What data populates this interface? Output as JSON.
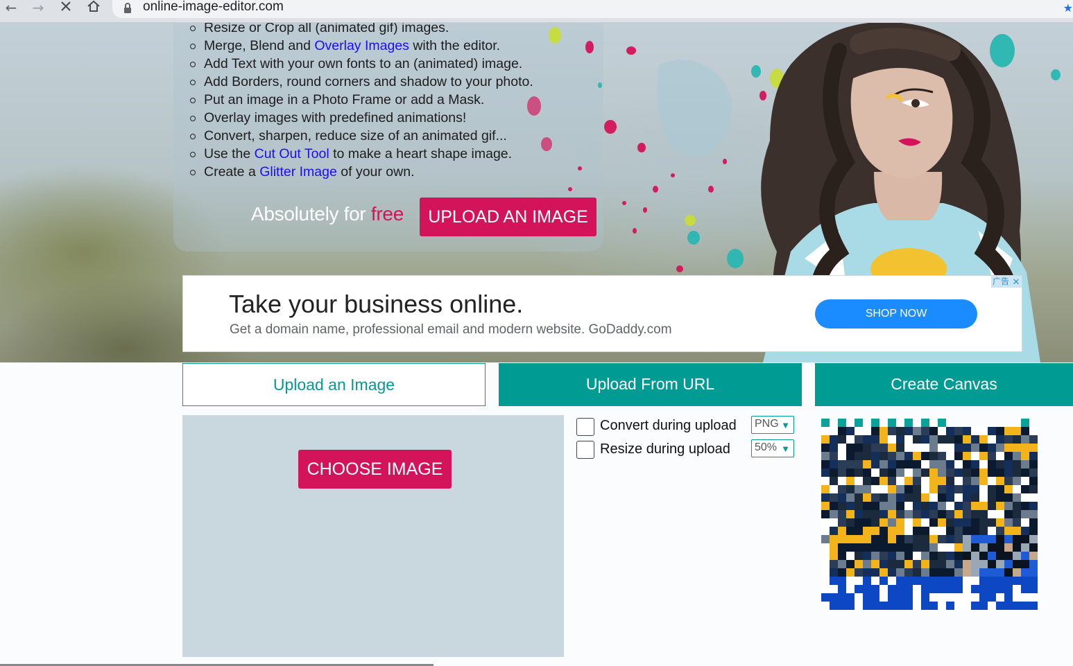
{
  "browser": {
    "url": "online-image-editor.com"
  },
  "hero": {
    "features": [
      {
        "before": "Resize or Crop all (animated gif) images.",
        "link": "",
        "after": ""
      },
      {
        "before": "Merge, Blend and ",
        "link": "Overlay Images",
        "after": " with the editor."
      },
      {
        "before": "Add Text with your own fonts to an (animated) image.",
        "link": "",
        "after": ""
      },
      {
        "before": "Add Borders, round corners and shadow to your photo.",
        "link": "",
        "after": ""
      },
      {
        "before": "Put an image in a Photo Frame or add a Mask.",
        "link": "",
        "after": ""
      },
      {
        "before": "Overlay images with predefined animations!",
        "link": "",
        "after": ""
      },
      {
        "before": "Convert, sharpen, reduce size of an animated gif...",
        "link": "",
        "after": ""
      },
      {
        "before": "Use the ",
        "link": "Cut Out Tool",
        "after": " to make a heart shape image."
      },
      {
        "before": "Create a ",
        "link": "Glitter Image",
        "after": " of your own."
      }
    ],
    "tagline_prefix": "Absolutely for ",
    "tagline_free": "free",
    "upload_button": "UPLOAD AN IMAGE"
  },
  "ad": {
    "title": "Take your business online.",
    "subtitle": "Get a domain name, professional email and modern website. GoDaddy.com",
    "button": "SHOP NOW",
    "badge": "广告",
    "close": "✕"
  },
  "tabs": {
    "upload": "Upload an Image",
    "url": "Upload From URL",
    "canvas": "Create Canvas"
  },
  "upload": {
    "choose_button": "CHOOSE IMAGE",
    "convert_label": "Convert during upload",
    "convert_format": "PNG",
    "resize_label": "Resize during upload",
    "resize_value": "50%"
  },
  "colors": {
    "accent_pink": "#d4145a",
    "teal": "#009b93",
    "link_blue": "#1a0dff",
    "ad_blue": "#1a8cff"
  }
}
